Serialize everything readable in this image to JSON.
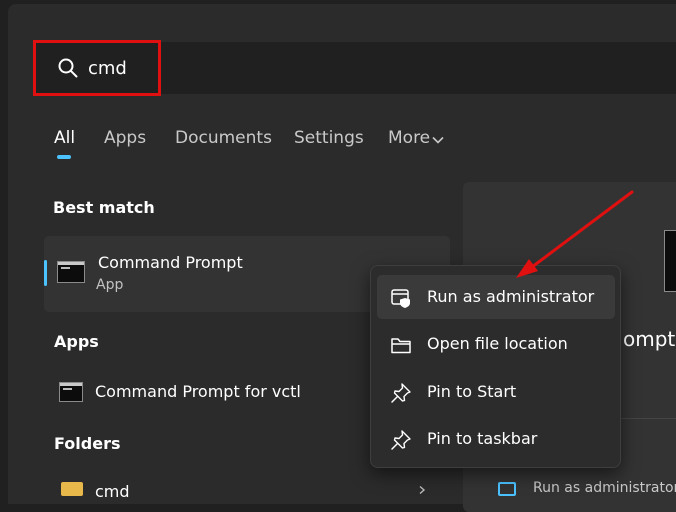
{
  "search": {
    "query": "cmd"
  },
  "tabs": [
    {
      "label": "All",
      "active": true
    },
    {
      "label": "Apps"
    },
    {
      "label": "Documents"
    },
    {
      "label": "Settings"
    },
    {
      "label": "More"
    }
  ],
  "best_match": {
    "section_title": "Best match",
    "title": "Command Prompt",
    "subtitle": "App"
  },
  "apps": {
    "section_title": "Apps",
    "items": [
      {
        "title": "Command Prompt for vctl"
      }
    ]
  },
  "folders": {
    "section_title": "Folders",
    "items": [
      {
        "title": "cmd"
      }
    ]
  },
  "context_menu": {
    "items": [
      {
        "label": "Run as administrator",
        "icon": "shield-admin-icon"
      },
      {
        "label": "Open file location",
        "icon": "folder-icon"
      },
      {
        "label": "Pin to Start",
        "icon": "pin-icon"
      },
      {
        "label": "Pin to taskbar",
        "icon": "pin-icon"
      }
    ]
  },
  "preview": {
    "title_fragment": "ompt",
    "action_fragment": "Run as administrator"
  },
  "colors": {
    "accent": "#4cc2ff",
    "highlight_box": "#e01010",
    "annotation_arrow": "#e01010",
    "background": "#2b2b2b"
  }
}
